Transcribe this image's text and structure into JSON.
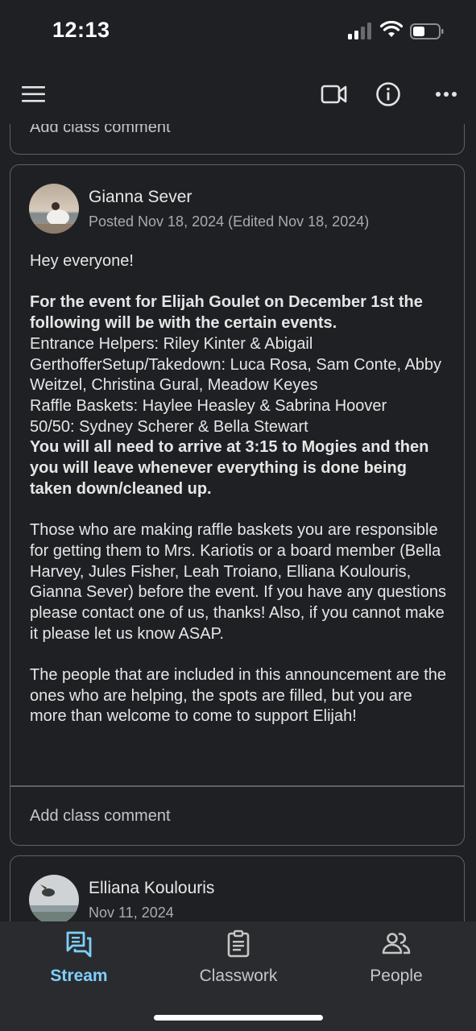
{
  "status_bar": {
    "time": "12:13"
  },
  "app_bar": {
    "icons": [
      "menu-icon",
      "video-call-icon",
      "info-icon",
      "more-icon"
    ]
  },
  "previous_post": {
    "comment_placeholder": "Add class comment"
  },
  "post": {
    "author": "Gianna Sever",
    "date": "Posted Nov 18, 2024 (Edited Nov 18, 2024)",
    "greeting": "Hey everyone!",
    "intro_bold": "For the event for Elijah Goulet on December 1st the following will be with the certain events.",
    "assignments": [
      "Entrance Helpers: Riley Kinter & Abigail GerthofferSetup/Takedown: Luca Rosa, Sam Conte, Abby Weitzel, Christina Gural, Meadow Keyes",
      "Raffle Baskets: Haylee Heasley & Sabrina Hoover",
      "50/50: Sydney Scherer & Bella Stewart"
    ],
    "arrival_bold": "You will all need to arrive at 3:15 to Mogies and then you will leave whenever everything is done being taken down/cleaned up.",
    "paragraph_raffle": "Those who are making raffle baskets you are responsible for getting them to Mrs. Kariotis or a board member (Bella Harvey, Jules Fisher, Leah Troiano, Elliana Koulouris, Gianna Sever) before the event. If you have any questions please contact one of us, thanks! Also, if you cannot make it please let us know ASAP.",
    "paragraph_people": "The people that are included in this announcement are the ones who are helping, the spots are filled, but you are more than welcome to come to support Elijah!",
    "comment_placeholder": "Add class comment"
  },
  "next_post": {
    "author": "Elliana Koulouris",
    "date": "Nov 11, 2024"
  },
  "bottom_nav": {
    "stream": "Stream",
    "classwork": "Classwork",
    "people": "People",
    "active": "Stream",
    "active_color": "#7fcfff"
  }
}
